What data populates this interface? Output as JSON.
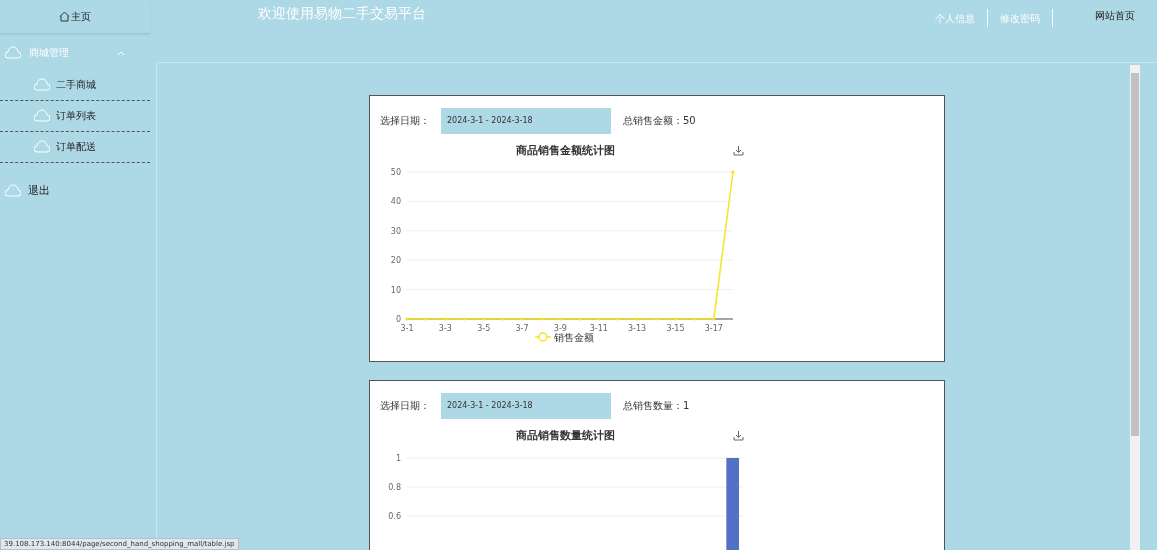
{
  "sidebar": {
    "home": "主页",
    "groups": [
      {
        "label": "商城管理",
        "expanded": true,
        "children": [
          {
            "label": "二手商城"
          },
          {
            "label": "订单列表"
          },
          {
            "label": "订单配送"
          }
        ]
      }
    ],
    "logout": "退出"
  },
  "header": {
    "title": "欢迎使用易物二手交易平台",
    "links": [
      "个人信息",
      "修改密码"
    ],
    "site_home": "网站首页"
  },
  "cards": [
    {
      "date_label": "选择日期：",
      "date_value": "2024-3-1 - 2024-3-18",
      "total_label": "总销售金额：",
      "total_value": "50",
      "chart_data": {
        "type": "line",
        "title": "商品销售金额统计图",
        "categories": [
          "3-1",
          null,
          "3-3",
          null,
          "3-5",
          null,
          "3-7",
          null,
          "3-9",
          null,
          "3-11",
          null,
          "3-13",
          null,
          "3-15",
          null,
          "3-17",
          null
        ],
        "grid": true,
        "series": [
          {
            "name": "销售金额",
            "color": "#f5e51e",
            "values": [
              0,
              0,
              0,
              0,
              0,
              0,
              0,
              0,
              0,
              0,
              0,
              0,
              0,
              0,
              0,
              0,
              0,
              50
            ]
          }
        ],
        "ylim": [
          0,
          50
        ],
        "yticks": [
          0,
          10,
          20,
          30,
          40,
          50
        ]
      }
    },
    {
      "date_label": "选择日期：",
      "date_value": "2024-3-1 - 2024-3-18",
      "total_label": "总销售数量：",
      "total_value": "1",
      "chart_data": {
        "type": "bar",
        "title": "商品销售数量统计图",
        "grid": true,
        "series": [
          {
            "color": "#5470c6",
            "values": [
              0,
              0,
              0,
              0,
              0,
              0,
              0,
              0,
              0,
              0,
              0,
              0,
              0,
              0,
              0,
              0,
              0,
              1
            ]
          }
        ],
        "ylim": [
          0,
          1
        ],
        "yticks": [
          {
            "value": 0.6,
            "label": "0.6"
          },
          {
            "value": 0.8,
            "label": "0.8"
          },
          {
            "value": 1,
            "label": "1"
          }
        ]
      }
    }
  ],
  "status_url": "39.108.173.140:8044/page/second_hand_shopping_mall/table.jsp"
}
